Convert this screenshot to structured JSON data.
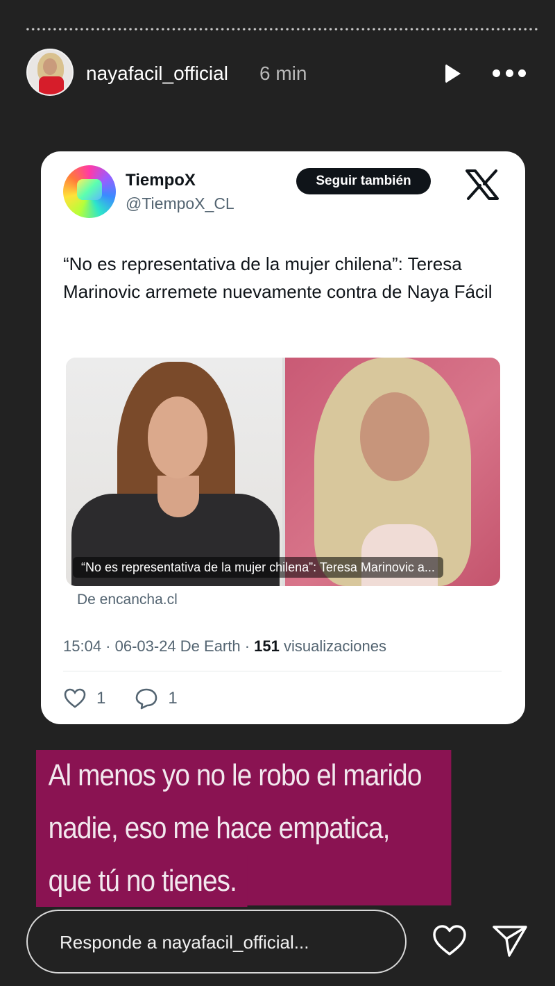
{
  "story": {
    "username": "nayafacil_official",
    "time": "6 min"
  },
  "tweet": {
    "name": "TiempoX",
    "handle": "@TiempoX_CL",
    "follow_label": "Seguir también",
    "text": "“No es representativa de la mujer chilena”: Teresa Marinovic arremete nuevamente contra de Naya Fácil",
    "media_caption": "“No es representativa de la mujer chilena”: Teresa Marinovic a...",
    "source": "De encancha.cl",
    "meta_prefix": "15:04 · 06-03-24 De Earth · ",
    "views_count": "151",
    "views_label": " visualizaciones",
    "likes": "1",
    "replies": "1"
  },
  "overlay_text": {
    "line1": "Al menos yo no le robo el marido a",
    "line2": "nadie, eso me hace empatica, algo",
    "line3": "que tú no tienes."
  },
  "reply": {
    "placeholder": "Responde a nayafacil_official..."
  },
  "colors": {
    "background": "#222222",
    "overlay": "#8a1352",
    "card": "#ffffff"
  }
}
